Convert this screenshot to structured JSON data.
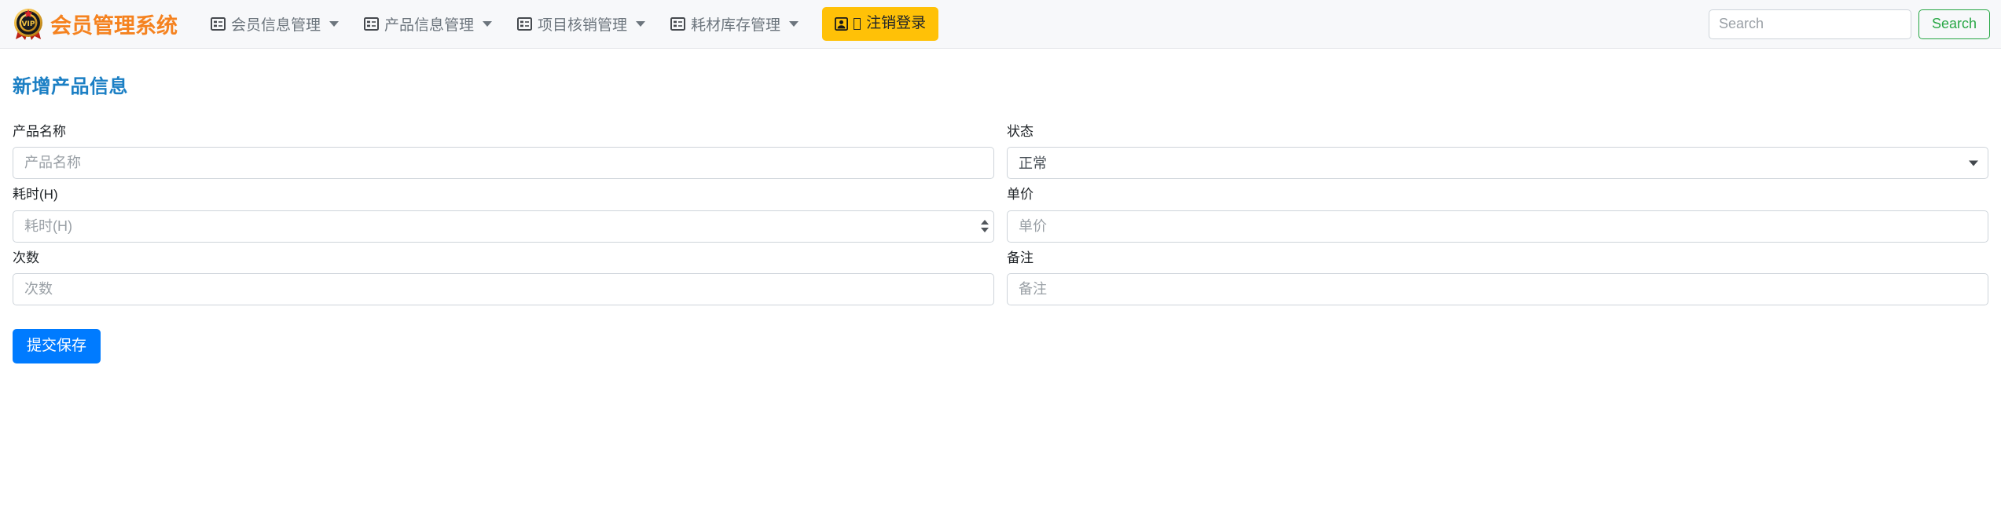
{
  "navbar": {
    "brand": {
      "text": "会员管理系统",
      "logo_icon": "vip-badge-icon"
    },
    "menu": [
      {
        "label": "会员信息管理",
        "icon": "list-alt-icon",
        "has_caret": true
      },
      {
        "label": "产品信息管理",
        "icon": "list-alt-icon",
        "has_caret": true
      },
      {
        "label": "项目核销管理",
        "icon": "list-alt-icon",
        "has_caret": true
      },
      {
        "label": "耗材库存管理",
        "icon": "list-alt-icon",
        "has_caret": true
      }
    ],
    "logout": {
      "label": "注销登录",
      "icon": "user-square-icon",
      "background": "#ffc107"
    },
    "search": {
      "placeholder": "Search",
      "value": "",
      "button_label": "Search",
      "button_color": "#28a745"
    }
  },
  "page": {
    "title": "新增产品信息",
    "title_color": "#1b7fc4"
  },
  "form": {
    "rows": [
      {
        "left": {
          "label": "产品名称",
          "type": "text",
          "placeholder": "产品名称",
          "value": ""
        },
        "right": {
          "label": "状态",
          "type": "select",
          "value": "正常",
          "options": [
            "正常"
          ]
        }
      },
      {
        "left": {
          "label": "耗时(H)",
          "type": "number",
          "placeholder": "耗时(H)",
          "value": ""
        },
        "right": {
          "label": "单价",
          "type": "text",
          "placeholder": "单价",
          "value": ""
        }
      },
      {
        "left": {
          "label": "次数",
          "type": "text",
          "placeholder": "次数",
          "value": ""
        },
        "right": {
          "label": "备注",
          "type": "text",
          "placeholder": "备注",
          "value": ""
        }
      }
    ],
    "submit_label": "提交保存",
    "submit_color": "#007bff"
  }
}
